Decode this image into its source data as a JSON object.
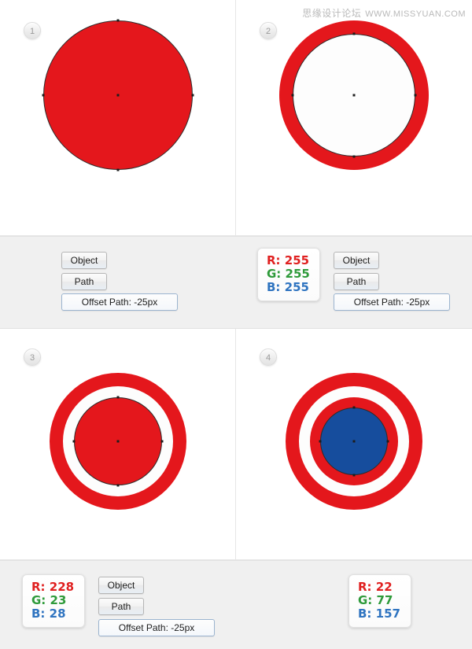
{
  "watermark": {
    "cn": "思缘设计论坛",
    "en": "WWW.MISSYUAN.COM"
  },
  "colors": {
    "red": "#e4171c",
    "blue": "#164d9d",
    "white": "#ffffff",
    "band": "#f0f0f0",
    "badge_text": "#9a9a9a"
  },
  "steps": [
    {
      "number": "1",
      "name": "red-filled-circle"
    },
    {
      "number": "2",
      "name": "red-ring-white-center"
    },
    {
      "number": "3",
      "name": "red-ring-white-gap-red-disc"
    },
    {
      "number": "4",
      "name": "captain-america-shield"
    }
  ],
  "menus": {
    "top": {
      "object_label": "Object",
      "path_label": "Path",
      "offset_label": "Offset Path: -25px"
    },
    "bottom": {
      "object_label": "Object",
      "path_label": "Path",
      "offset_label": "Offset Path: -25px"
    }
  },
  "swatches": {
    "white": {
      "r": "R: 255",
      "g": "G: 255",
      "b": "B: 255"
    },
    "red": {
      "r": "R: 228",
      "g": "G: 23",
      "b": "B: 28"
    },
    "blue": {
      "r": "R: 22",
      "g": "G: 77",
      "b": "B: 157"
    }
  }
}
